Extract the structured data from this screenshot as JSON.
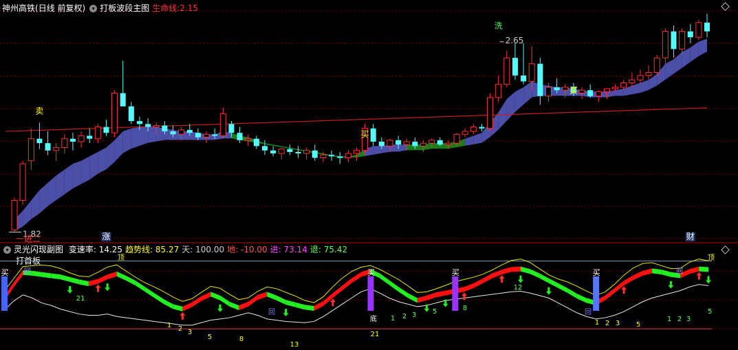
{
  "main_header": {
    "stock": "神州高铁",
    "period": "(日线 前复权)",
    "indicator": "打板波段主图",
    "lifeline_label": "生命线:",
    "lifeline_value": "2.15"
  },
  "sub_header": {
    "indicator": "灵光闪现副图",
    "items": [
      {
        "label": "变速率:",
        "value": "14.25",
        "color": "#ffffff"
      },
      {
        "label": "趋势线:",
        "value": "85.27",
        "color": "#ffff00"
      },
      {
        "label": "天:",
        "value": "100.00",
        "color": "#cccccc"
      },
      {
        "label": "地:",
        "value": "-10.00",
        "color": "#ff5555"
      },
      {
        "label": "进:",
        "value": "73.14",
        "color": "#ff44ff"
      },
      {
        "label": "退:",
        "value": "75.42",
        "color": "#55ff55"
      }
    ]
  },
  "colors": {
    "up": "#ff3232",
    "down": "#54fcfc",
    "ribbon_bull": "#4b4fa8",
    "ribbon_bear": "#1d7a1d",
    "lifeline": "#c02020",
    "grid": "#7a0000"
  },
  "chart_data": [
    {
      "type": "candlestick",
      "title": "打板波段主图",
      "ohlc": [
        [
          1.83,
          2.05,
          1.82,
          2.03
        ],
        [
          2.03,
          2.3,
          2.0,
          2.28
        ],
        [
          2.3,
          2.52,
          2.24,
          2.45
        ],
        [
          2.45,
          2.56,
          2.38,
          2.42
        ],
        [
          2.42,
          2.5,
          2.34,
          2.37
        ],
        [
          2.37,
          2.42,
          2.3,
          2.39
        ],
        [
          2.39,
          2.48,
          2.35,
          2.45
        ],
        [
          2.45,
          2.49,
          2.37,
          2.43
        ],
        [
          2.43,
          2.5,
          2.39,
          2.47
        ],
        [
          2.47,
          2.52,
          2.42,
          2.45
        ],
        [
          2.45,
          2.55,
          2.42,
          2.53
        ],
        [
          2.53,
          2.58,
          2.47,
          2.49
        ],
        [
          2.49,
          2.78,
          2.46,
          2.76
        ],
        [
          2.76,
          2.98,
          2.68,
          2.67
        ],
        [
          2.67,
          2.7,
          2.55,
          2.57
        ],
        [
          2.57,
          2.6,
          2.51,
          2.55
        ],
        [
          2.55,
          2.59,
          2.5,
          2.53
        ],
        [
          2.53,
          2.56,
          2.48,
          2.54
        ],
        [
          2.54,
          2.57,
          2.48,
          2.5
        ],
        [
          2.5,
          2.54,
          2.46,
          2.48
        ],
        [
          2.48,
          2.53,
          2.44,
          2.51
        ],
        [
          2.51,
          2.55,
          2.47,
          2.49
        ],
        [
          2.49,
          2.52,
          2.44,
          2.46
        ],
        [
          2.46,
          2.5,
          2.42,
          2.48
        ],
        [
          2.48,
          2.52,
          2.45,
          2.47
        ],
        [
          2.47,
          2.66,
          2.45,
          2.62
        ],
        [
          2.55,
          2.57,
          2.46,
          2.49
        ],
        [
          2.49,
          2.53,
          2.42,
          2.44
        ],
        [
          2.44,
          2.48,
          2.4,
          2.45
        ],
        [
          2.45,
          2.47,
          2.38,
          2.4
        ],
        [
          2.4,
          2.44,
          2.34,
          2.37
        ],
        [
          2.37,
          2.4,
          2.33,
          2.35
        ],
        [
          2.35,
          2.39,
          2.31,
          2.38
        ],
        [
          2.38,
          2.41,
          2.34,
          2.36
        ],
        [
          2.36,
          2.4,
          2.32,
          2.35
        ],
        [
          2.35,
          2.39,
          2.31,
          2.37
        ],
        [
          2.37,
          2.41,
          2.3,
          2.32
        ],
        [
          2.32,
          2.36,
          2.29,
          2.34
        ],
        [
          2.34,
          2.37,
          2.3,
          2.33
        ],
        [
          2.33,
          2.36,
          2.28,
          2.32
        ],
        [
          2.32,
          2.37,
          2.29,
          2.35
        ],
        [
          2.35,
          2.39,
          2.3,
          2.37
        ],
        [
          2.37,
          2.55,
          2.34,
          2.52
        ],
        [
          2.52,
          2.55,
          2.4,
          2.43
        ],
        [
          2.43,
          2.46,
          2.38,
          2.4
        ],
        [
          2.4,
          2.45,
          2.36,
          2.44
        ],
        [
          2.44,
          2.47,
          2.38,
          2.41
        ],
        [
          2.41,
          2.45,
          2.37,
          2.43
        ],
        [
          2.43,
          2.46,
          2.38,
          2.4
        ],
        [
          2.4,
          2.44,
          2.36,
          2.42
        ],
        [
          2.42,
          2.45,
          2.39,
          2.44
        ],
        [
          2.44,
          2.46,
          2.4,
          2.41
        ],
        [
          2.41,
          2.44,
          2.38,
          2.42
        ],
        [
          2.42,
          2.49,
          2.4,
          2.48
        ],
        [
          2.48,
          2.52,
          2.46,
          2.5
        ],
        [
          2.5,
          2.55,
          2.48,
          2.53
        ],
        [
          2.53,
          2.55,
          2.5,
          2.52
        ],
        [
          2.52,
          2.76,
          2.5,
          2.73
        ],
        [
          2.73,
          2.88,
          2.7,
          2.82
        ],
        [
          2.82,
          3.05,
          2.8,
          3.0
        ],
        [
          3.0,
          3.1,
          2.85,
          2.88
        ],
        [
          2.88,
          3.1,
          2.82,
          2.84
        ],
        [
          2.84,
          3.08,
          2.78,
          2.96
        ],
        [
          2.96,
          3.0,
          2.68,
          2.74
        ],
        [
          2.74,
          2.83,
          2.7,
          2.8
        ],
        [
          2.8,
          2.86,
          2.76,
          2.78
        ],
        [
          2.78,
          2.82,
          2.73,
          2.8
        ],
        [
          2.8,
          2.83,
          2.74,
          2.76
        ],
        [
          2.76,
          2.8,
          2.72,
          2.78
        ],
        [
          2.78,
          2.82,
          2.73,
          2.74
        ],
        [
          2.74,
          2.78,
          2.7,
          2.77
        ],
        [
          2.77,
          2.79,
          2.72,
          2.79
        ],
        [
          2.79,
          2.82,
          2.77,
          2.8
        ],
        [
          2.8,
          2.85,
          2.78,
          2.83
        ],
        [
          2.83,
          2.9,
          2.8,
          2.85
        ],
        [
          2.85,
          2.92,
          2.82,
          2.88
        ],
        [
          2.88,
          2.95,
          2.85,
          2.9
        ],
        [
          2.9,
          3.02,
          2.88,
          3.0
        ],
        [
          3.0,
          3.2,
          2.96,
          3.18
        ],
        [
          3.18,
          3.22,
          3.0,
          3.06
        ],
        [
          3.06,
          3.2,
          3.02,
          3.18
        ],
        [
          3.18,
          3.23,
          3.1,
          3.14
        ],
        [
          3.14,
          3.26,
          3.12,
          3.24
        ],
        [
          3.24,
          3.3,
          3.14,
          3.18
        ]
      ],
      "ribbon_fast": [
        1.9,
        1.96,
        2.03,
        2.1,
        2.15,
        2.2,
        2.24,
        2.28,
        2.3,
        2.33,
        2.36,
        2.39,
        2.44,
        2.5,
        2.52,
        2.53,
        2.53,
        2.53,
        2.52,
        2.51,
        2.5,
        2.5,
        2.49,
        2.48,
        2.48,
        2.5,
        2.49,
        2.47,
        2.46,
        2.44,
        2.42,
        2.41,
        2.4,
        2.39,
        2.38,
        2.37,
        2.36,
        2.35,
        2.34,
        2.33,
        2.33,
        2.34,
        2.38,
        2.4,
        2.4,
        2.41,
        2.41,
        2.41,
        2.41,
        2.41,
        2.42,
        2.42,
        2.42,
        2.43,
        2.45,
        2.47,
        2.49,
        2.56,
        2.63,
        2.72,
        2.77,
        2.8,
        2.84,
        2.82,
        2.81,
        2.8,
        2.8,
        2.79,
        2.78,
        2.77,
        2.77,
        2.77,
        2.78,
        2.79,
        2.81,
        2.83,
        2.85,
        2.89,
        2.96,
        2.99,
        3.04,
        3.07,
        3.11,
        3.13
      ],
      "ribbon_slow": [
        1.85,
        1.88,
        1.93,
        1.97,
        2.02,
        2.06,
        2.1,
        2.14,
        2.17,
        2.2,
        2.24,
        2.27,
        2.32,
        2.38,
        2.41,
        2.43,
        2.45,
        2.46,
        2.47,
        2.47,
        2.47,
        2.47,
        2.47,
        2.47,
        2.47,
        2.48,
        2.48,
        2.47,
        2.46,
        2.45,
        2.44,
        2.43,
        2.42,
        2.41,
        2.4,
        2.39,
        2.38,
        2.37,
        2.36,
        2.35,
        2.35,
        2.35,
        2.36,
        2.37,
        2.38,
        2.39,
        2.39,
        2.4,
        2.4,
        2.4,
        2.41,
        2.41,
        2.41,
        2.42,
        2.43,
        2.44,
        2.45,
        2.49,
        2.54,
        2.6,
        2.66,
        2.71,
        2.76,
        2.77,
        2.77,
        2.77,
        2.77,
        2.77,
        2.77,
        2.76,
        2.76,
        2.76,
        2.77,
        2.77,
        2.78,
        2.79,
        2.81,
        2.84,
        2.88,
        2.92,
        2.96,
        3.0,
        3.04,
        3.07
      ],
      "lifeline": {
        "start": 2.5,
        "end": 2.66,
        "label_value": "2.15"
      },
      "ylim": [
        1.78,
        3.3
      ],
      "labels": [
        {
          "text": "1.82",
          "i": 0,
          "price": 1.82,
          "color": "#cccccc",
          "kind": "low"
        },
        {
          "text": "2.65",
          "i": 58,
          "price": 3.1,
          "color": "#cccccc",
          "kind": "high"
        },
        {
          "text": "一进二",
          "i": 0,
          "price": 1.75,
          "color": "#ff4444",
          "kind": "tag"
        },
        {
          "text": "打首板",
          "i": 0,
          "price": 1.6,
          "color": "#ffffff",
          "kind": "tag"
        },
        {
          "text": "卖",
          "i": 3,
          "price": 2.62,
          "color": "#ffff00",
          "kind": "tag"
        },
        {
          "text": "洗",
          "i": 58,
          "price": 3.2,
          "color": "#55ff55",
          "kind": "tag"
        },
        {
          "text": "买",
          "i": 42,
          "price": 2.46,
          "color": "#ffff00",
          "kind": "tag"
        },
        {
          "text": "买",
          "i": 67,
          "price": 2.76,
          "color": "#ffff00",
          "kind": "tag"
        },
        {
          "text": "涨",
          "i": 11,
          "price": 0,
          "color": "#ffffff",
          "kind": "bottom"
        },
        {
          "text": "财",
          "i": 81,
          "price": 0,
          "color": "#ffffff",
          "kind": "bottom"
        }
      ]
    },
    {
      "type": "line",
      "title": "灵光闪现副图",
      "ylim": [
        -12,
        104
      ],
      "trend": [
        42,
        65,
        85,
        84,
        82,
        80,
        78,
        74,
        70,
        67,
        71,
        78,
        83,
        76,
        68,
        58,
        48,
        38,
        30,
        26,
        33,
        43,
        50,
        44,
        34,
        28,
        34,
        45,
        50,
        44,
        37,
        33,
        29,
        27,
        35,
        48,
        60,
        72,
        82,
        87,
        80,
        69,
        58,
        48,
        40,
        44,
        49,
        52,
        55,
        58,
        64,
        72,
        80,
        86,
        90,
        91,
        87,
        80,
        72,
        64,
        56,
        47,
        40,
        36,
        44,
        56,
        68,
        77,
        84,
        88,
        86,
        82,
        80,
        87,
        91,
        90
      ],
      "advance": [
        0,
        72,
        85,
        84,
        null,
        null,
        null,
        null,
        null,
        null,
        null,
        76,
        86,
        null,
        null,
        null,
        null,
        null,
        null,
        null,
        null,
        null,
        null,
        null,
        null,
        null,
        null,
        null,
        null,
        null,
        null,
        null,
        null,
        null,
        null,
        null,
        null,
        null,
        null,
        null,
        null,
        null,
        null,
        null,
        null,
        null,
        null,
        null,
        null,
        null,
        null,
        null,
        null,
        null,
        null,
        null,
        null,
        null,
        null,
        null,
        null,
        null,
        null,
        null,
        null,
        null,
        null,
        null,
        null,
        null,
        null,
        null,
        null,
        null,
        null,
        null
      ],
      "white": [
        20,
        35,
        45,
        40,
        32,
        28,
        22,
        18,
        14,
        12,
        12,
        14,
        10,
        8,
        6,
        4,
        2,
        0,
        -2,
        -4,
        -4,
        0,
        4,
        6,
        8,
        12,
        16,
        12,
        6,
        4,
        2,
        1,
        0,
        2,
        10,
        20,
        30,
        40,
        50,
        55,
        48,
        40,
        34,
        30,
        26,
        28,
        32,
        36,
        38,
        40,
        42,
        44,
        46,
        48,
        50,
        51,
        48,
        44,
        40,
        32,
        24,
        16,
        10,
        6,
        8,
        12,
        18,
        26,
        34,
        40,
        44,
        48,
        52,
        58,
        62,
        60
      ],
      "sky": 100,
      "ground": -10,
      "signals_buy": [
        {
          "i": 0,
          "text": "买"
        },
        {
          "i": 39,
          "text": "买"
        },
        {
          "i": 48,
          "text": "买"
        },
        {
          "i": 63,
          "text": "买"
        }
      ],
      "labels": [
        {
          "text": "回",
          "x": 40,
          "y": 398,
          "color": "#aa88ff"
        },
        {
          "text": "回",
          "x": 988,
          "y": 398,
          "color": "#aa88ff"
        },
        {
          "text": "底",
          "x": 543,
          "y": 467,
          "color": "#ffffff"
        },
        {
          "text": "顶",
          "x": 176,
          "y": 378,
          "color": "#ffff00"
        },
        {
          "text": "顶",
          "x": 1034,
          "y": 378,
          "color": "#ffff00"
        },
        {
          "text": "回",
          "x": 395,
          "y": 457,
          "color": "#7777ff"
        },
        {
          "text": "回",
          "x": 855,
          "y": 457,
          "color": "#7777ff"
        },
        {
          "text": "21",
          "x": 117,
          "y": 437,
          "color": "#55ff55"
        },
        {
          "text": "12",
          "x": 753,
          "y": 421,
          "color": "#55ff55"
        },
        {
          "text": "8",
          "x": 676,
          "y": 451,
          "color": "#55ff55"
        },
        {
          "text": "1",
          "x": 571,
          "y": 466,
          "color": "#55ff55"
        },
        {
          "text": "2",
          "x": 588,
          "y": 463,
          "color": "#55ff55"
        },
        {
          "text": "3",
          "x": 602,
          "y": 461,
          "color": "#55ff55"
        },
        {
          "text": "5",
          "x": 632,
          "y": 456,
          "color": "#55ff55"
        },
        {
          "text": "1",
          "x": 973,
          "y": 467,
          "color": "#55ff55"
        },
        {
          "text": "2",
          "x": 988,
          "y": 467,
          "color": "#55ff55"
        },
        {
          "text": "3",
          "x": 1001,
          "y": 467,
          "color": "#55ff55"
        },
        {
          "text": "5",
          "x": 1032,
          "y": 456,
          "color": "#55ff55"
        },
        {
          "text": "1",
          "x": 246,
          "y": 476,
          "color": "#ffff00"
        },
        {
          "text": "2",
          "x": 262,
          "y": 481,
          "color": "#ffff00"
        },
        {
          "text": "3",
          "x": 276,
          "y": 486,
          "color": "#ffff00"
        },
        {
          "text": "5",
          "x": 305,
          "y": 493,
          "color": "#ffff00"
        },
        {
          "text": "8",
          "x": 351,
          "y": 496,
          "color": "#ffff00"
        },
        {
          "text": "13",
          "x": 428,
          "y": 504,
          "color": "#ffff00"
        },
        {
          "text": "21",
          "x": 545,
          "y": 489,
          "color": "#ffff00"
        },
        {
          "text": "1",
          "x": 868,
          "y": 472,
          "color": "#ffff00"
        },
        {
          "text": "2",
          "x": 883,
          "y": 473,
          "color": "#ffff00"
        },
        {
          "text": "3",
          "x": 898,
          "y": 473,
          "color": "#ffff00"
        },
        {
          "text": "5",
          "x": 928,
          "y": 475,
          "color": "#ffff00"
        }
      ],
      "arrows_up": [
        10,
        19,
        35,
        49,
        53,
        66,
        74
      ],
      "arrows_down": [
        7,
        11,
        23,
        30,
        45,
        47,
        55,
        58,
        71,
        75
      ]
    }
  ]
}
